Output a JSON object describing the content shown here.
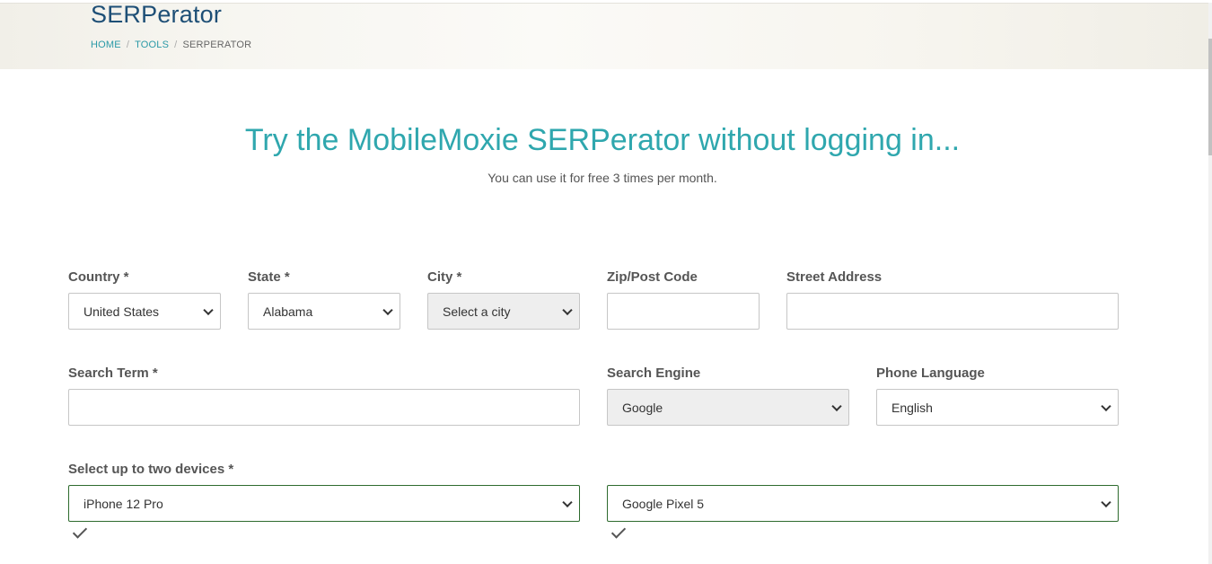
{
  "header": {
    "title": "SERPerator",
    "breadcrumb": {
      "home": "HOME",
      "tools": "TOOLS",
      "current": "SERPERATOR",
      "separator": "/"
    }
  },
  "hero": {
    "title": "Try the MobileMoxie SERPerator without logging in...",
    "subtitle": "You can use it for free 3 times per month."
  },
  "form": {
    "country": {
      "label": "Country *",
      "value": "United States"
    },
    "state": {
      "label": "State *",
      "value": "Alabama"
    },
    "city": {
      "label": "City *",
      "value": "Select a city"
    },
    "zip": {
      "label": "Zip/Post Code",
      "value": ""
    },
    "street": {
      "label": "Street Address",
      "value": ""
    },
    "search_term": {
      "label": "Search Term *",
      "value": ""
    },
    "search_engine": {
      "label": "Search Engine",
      "value": "Google"
    },
    "phone_language": {
      "label": "Phone Language",
      "value": "English"
    },
    "devices": {
      "label": "Select up to two devices *",
      "device1": "iPhone 12 Pro",
      "device2": "Google Pixel 5"
    }
  },
  "colors": {
    "accent": "#2fa7ae",
    "title_blue": "#1e4f76",
    "valid_border": "#2e6b2e",
    "disabled_bg": "#eeeeee"
  },
  "icons": [
    "chevron-down-icon",
    "checkmark-icon"
  ]
}
